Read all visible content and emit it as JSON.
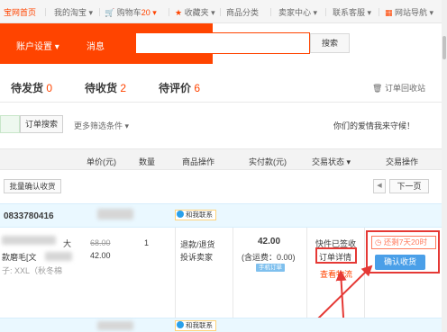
{
  "topnav": {
    "home": "宝网首页",
    "my_taobao": "我的淘宝",
    "cart_label": "购物车",
    "cart_count": "20",
    "favorites": "收藏夹",
    "categories": "商品分类",
    "seller_center": "卖家中心",
    "contact_service": "联系客服",
    "site_nav": "网站导航"
  },
  "header": {
    "account_settings": "账户设置",
    "messages": "消息",
    "search_button": "搜索"
  },
  "tabs": [
    {
      "label": "待发货",
      "count": "0"
    },
    {
      "label": "待收货",
      "count": "2"
    },
    {
      "label": "待评价",
      "count": "6"
    }
  ],
  "recycle_bin": "订单回收站",
  "filter": {
    "order_search_button": "订单搜索",
    "more_filters": "更多筛选条件",
    "protect_text": "你们的爱情我来守候！"
  },
  "columns": [
    "单价(元)",
    "数量",
    "商品操作",
    "实付款(元)",
    "交易状态",
    "交易操作"
  ],
  "batch_confirm": "批量确认收货",
  "next_page": "下一页",
  "order": {
    "order_no": "0833780416",
    "contact_label": "和我联系",
    "title_suffix": "大",
    "title_line2": "款磨毛[文",
    "sku": "子: XXL（秋冬棉",
    "original_price": "68.00",
    "price": "42.00",
    "quantity": "1",
    "refund": "退款/退货",
    "complaint": "投诉卖家",
    "paid": "42.00",
    "shipping": "(含运费：0.00)",
    "phone_order": "手机订单",
    "status": "快件已签收",
    "detail": "订单详情",
    "logistics": "查看物流",
    "remaining": "还剩7天20时",
    "confirm_button": "确认收货"
  },
  "next_order": {
    "contact_label": "和我联系"
  },
  "colors": {
    "brand_orange": "#ff4400",
    "annotation_red": "#e53935",
    "confirm_blue": "#4a9fe8",
    "order_header_bg": "#eaf8ff"
  }
}
